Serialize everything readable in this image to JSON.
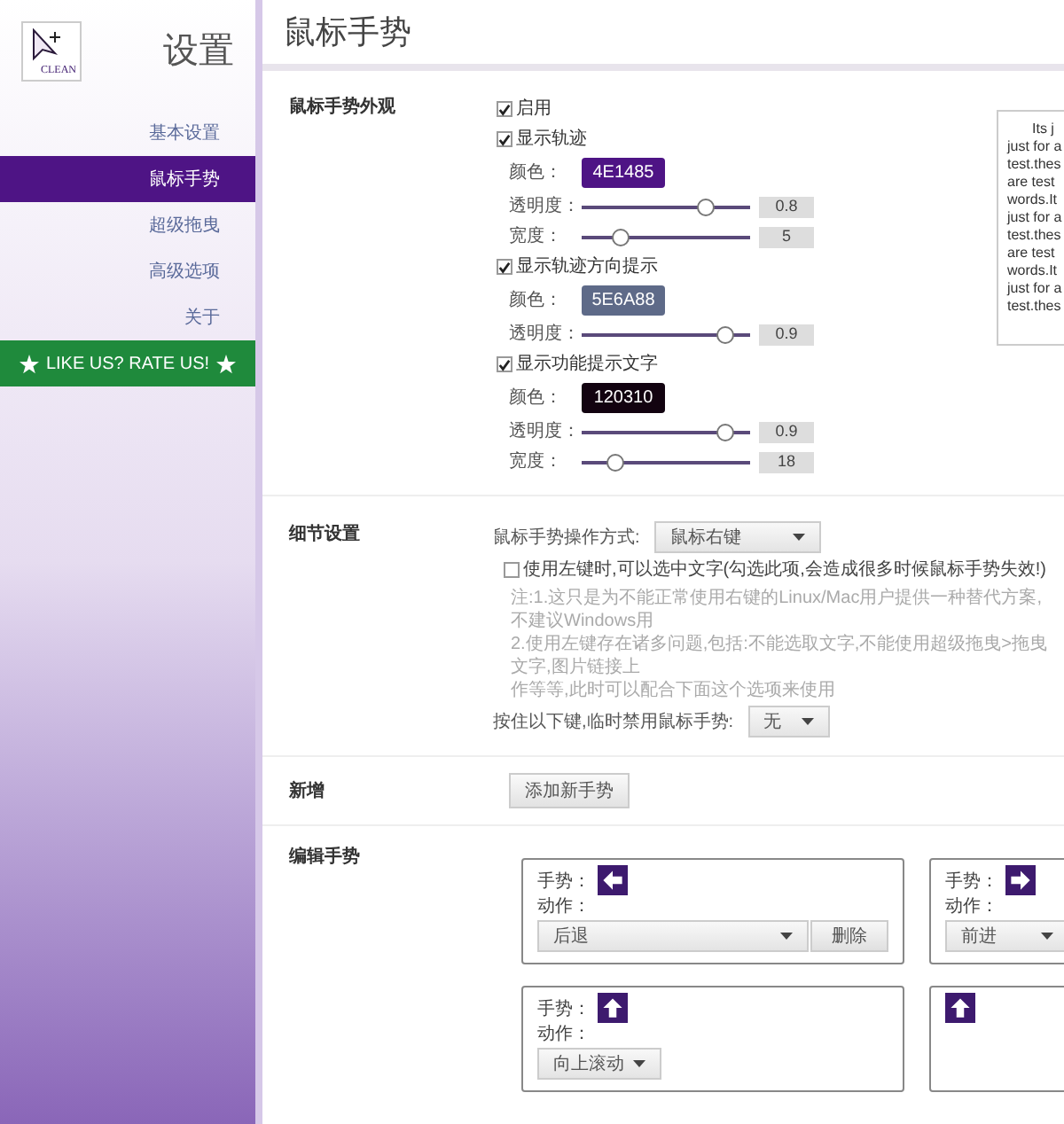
{
  "sidebar": {
    "logo_text": "CLEAN",
    "title": "设置",
    "items": [
      {
        "label": "基本设置",
        "selected": false
      },
      {
        "label": "鼠标手势",
        "selected": true
      },
      {
        "label": "超级拖曳",
        "selected": false
      },
      {
        "label": "高级选项",
        "selected": false
      },
      {
        "label": "关于",
        "selected": false
      }
    ],
    "rate_banner": "LIKE US? RATE US!"
  },
  "page_title": "鼠标手势",
  "appearance": {
    "label": "鼠标手势外观",
    "items": [
      {
        "kind": "checkbox",
        "label": "启用",
        "checked": true
      },
      {
        "kind": "checkbox",
        "label": "显示轨迹",
        "checked": true
      },
      {
        "kind": "color",
        "label": "颜色：",
        "value": "4E1485",
        "color": "#4e1485"
      },
      {
        "kind": "slider",
        "label": "透明度：",
        "level": 0.74,
        "reading": "0.8"
      },
      {
        "kind": "slider",
        "label": "宽度：",
        "level": 0.23,
        "reading": "5"
      },
      {
        "kind": "checkbox",
        "label": "显示轨迹方向提示",
        "checked": true
      },
      {
        "kind": "color",
        "label": "颜色：",
        "value": "5E6A88",
        "color": "#5e6a88"
      },
      {
        "kind": "slider",
        "label": "透明度：",
        "level": 0.85,
        "reading": "0.9"
      },
      {
        "kind": "checkbox",
        "label": "显示功能提示文字",
        "checked": true
      },
      {
        "kind": "color",
        "label": "颜色：",
        "value": "120310",
        "color": "#120310"
      },
      {
        "kind": "slider",
        "label": "透明度：",
        "level": 0.85,
        "reading": "0.9"
      },
      {
        "kind": "slider",
        "label": "宽度：",
        "level": 0.2,
        "reading": "18"
      }
    ],
    "preview_lines": [
      "Its j",
      "just for a",
      "test.thes",
      "are test",
      "words.It",
      "just for a",
      "test.thes",
      "are test",
      "words.It",
      "just for a",
      "test.thes"
    ]
  },
  "details": {
    "label": "细节设置",
    "mode_label": "鼠标手势操作方式:",
    "mode_value": "鼠标右键",
    "left_select": {
      "label": "使用左键时,可以选中文字(勾选此项,会造成很多时候鼠标手势失效!)",
      "checked": false
    },
    "notes": [
      "注:1.这只是为不能正常使用右键的Linux/Mac用户提供一种替代方案,不建议Windows用",
      "2.使用左键存在诸多问题,包括:不能选取文字,不能使用超级拖曳>拖曳文字,图片链接上",
      "作等等,此时可以配合下面这个选项来使用"
    ],
    "disable_label": "按住以下键,临时禁用鼠标手势:",
    "disable_value": "无"
  },
  "add": {
    "label": "新增",
    "button": "添加新手势"
  },
  "edit": {
    "label": "编辑手势",
    "cards": [
      {
        "kind": "left",
        "gesture_label": "手势：",
        "action_label": "动作：",
        "action": "后退",
        "delete": "删除"
      },
      {
        "kind": "right",
        "gesture_label": "手势：",
        "action_label": "动作：",
        "action": "前进"
      },
      {
        "kind": "up",
        "gesture_label": "手势：",
        "action_label": "动作：",
        "action": "向上滚动"
      },
      {
        "kind": "up"
      }
    ]
  }
}
